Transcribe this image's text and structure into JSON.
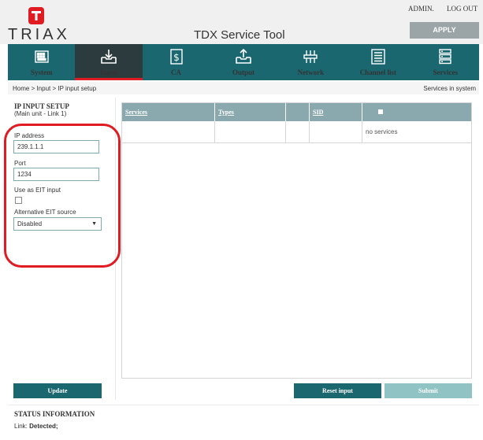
{
  "header": {
    "brand": "TRIAX",
    "app_title": "TDX Service Tool",
    "admin_label": "ADMIN.",
    "logout_label": "LOG OUT",
    "apply_label": "APPLY"
  },
  "nav": [
    {
      "label": "System",
      "icon": "keyboard-icon"
    },
    {
      "label": "Input",
      "icon": "input-tray-icon",
      "active": true
    },
    {
      "label": "CA",
      "icon": "dollar-card-icon"
    },
    {
      "label": "Output",
      "icon": "output-tray-icon"
    },
    {
      "label": "Network",
      "icon": "network-icon"
    },
    {
      "label": "Channel list",
      "icon": "list-icon"
    },
    {
      "label": "Services",
      "icon": "services-icon"
    }
  ],
  "breadcrumb": {
    "text": "Home  >  Input  >  IP input setup",
    "right": "Services in system"
  },
  "form": {
    "title": "IP INPUT SETUP",
    "subtitle": "(Main unit - Link 1)",
    "ip_label": "IP address",
    "ip_value": "239.1.1.1",
    "port_label": "Port",
    "port_value": "1234",
    "eit_label": "Use as EIT input",
    "alt_eit_label": "Alternative EIT source",
    "alt_eit_value": "Disabled",
    "update_label": "Update"
  },
  "table": {
    "headers": [
      "Services",
      "Types",
      "",
      "SID"
    ],
    "empty_text": "no services"
  },
  "buttons": {
    "reset": "Reset input",
    "submit": "Submit"
  },
  "status": {
    "title": "STATUS INFORMATION",
    "link_label": "Link:",
    "link_value": "Detected;"
  },
  "colors": {
    "brand_red": "#e01b22",
    "nav_teal": "#1b6770",
    "nav_active": "#2c3b3e",
    "table_header": "#8aa9ae"
  }
}
